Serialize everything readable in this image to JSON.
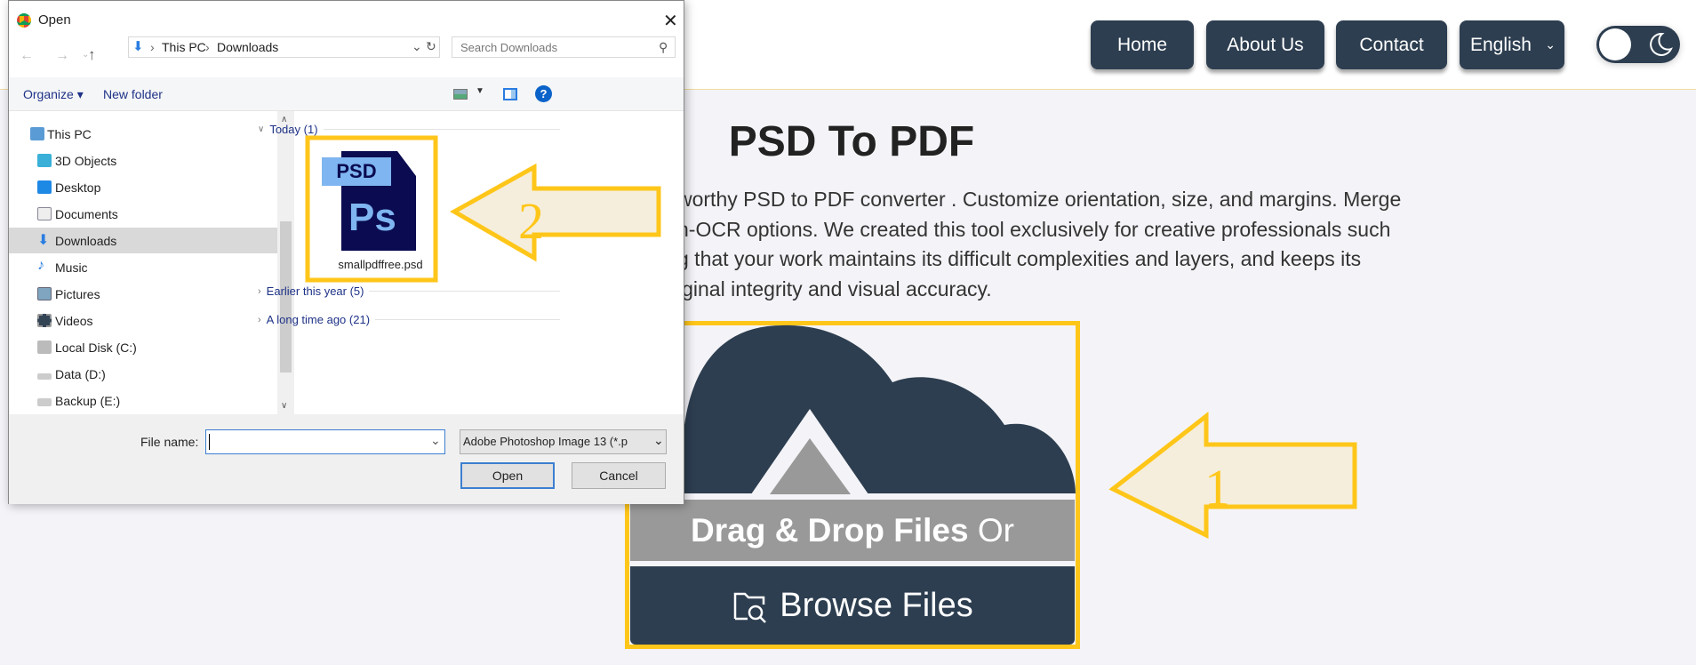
{
  "header": {
    "nav": [
      {
        "label": "Home"
      },
      {
        "label": "About Us"
      },
      {
        "label": "Contact"
      }
    ],
    "language": "English",
    "theme_toggle_icon": "moon-icon"
  },
  "main": {
    "title": "PSD To PDF",
    "description_lines": [
      "worthy PSD to PDF converter . Customize orientation, size, and margins. Merge",
      "n-OCR options. We created this tool exclusively for creative professionals such",
      "g that your work maintains its difficult complexities and layers, and keeps its",
      "iginal integrity and visual accuracy."
    ],
    "upload": {
      "drag_bold": "Drag & Drop Files",
      "drag_rest": " Or",
      "browse": "Browse Files"
    },
    "annotations": [
      "1",
      "2"
    ]
  },
  "dialog": {
    "title": "Open",
    "breadcrumb": [
      "This PC",
      "Downloads"
    ],
    "search_placeholder": "Search Downloads",
    "toolbar": {
      "organize": "Organize",
      "new_folder": "New folder"
    },
    "nav_items": [
      "This PC",
      "3D Objects",
      "Desktop",
      "Documents",
      "Downloads",
      "Music",
      "Pictures",
      "Videos",
      "Local Disk (C:)",
      "Data (D:)",
      "Backup (E:)"
    ],
    "selected_nav": "Downloads",
    "groups": {
      "today": "Today (1)",
      "earlier": "Earlier this year (5)",
      "long_ago": "A long time ago (21)"
    },
    "file": {
      "name": "smallpdffree.psd",
      "icon_badge": "PSD",
      "icon_text": "Ps"
    },
    "file_name_label": "File name:",
    "file_name_value": "",
    "file_type": "Adobe Photoshop Image 13 (*.p",
    "open": "Open",
    "cancel": "Cancel"
  },
  "colors": {
    "accent": "#2d3e50",
    "highlight": "#ffc61a",
    "arrow_fill": "#f5eedc"
  }
}
